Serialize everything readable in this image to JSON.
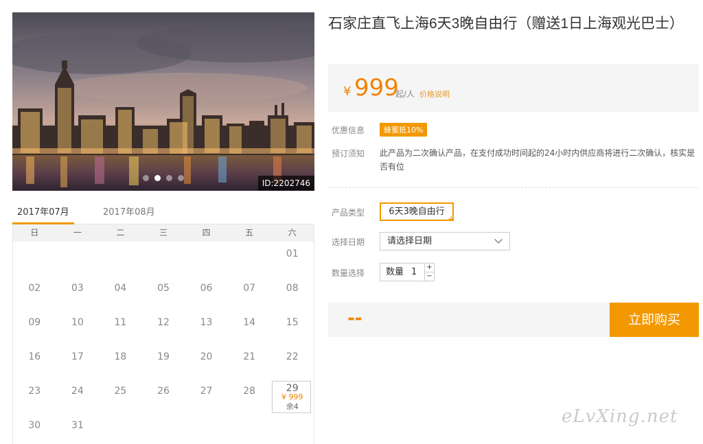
{
  "product": {
    "title": "石家庄直飞上海6天3晚自由行（赠送1日上海观光巴士）",
    "image_id": "ID:2202746",
    "price_currency": "¥",
    "price_amount": "999",
    "price_unit": "起/人",
    "price_explain": "价格说明"
  },
  "carousel": {
    "dot_count": 4,
    "active_dot": 1
  },
  "calendar": {
    "tabs": [
      {
        "label": "2017年07月",
        "active": true
      },
      {
        "label": "2017年08月",
        "active": false
      }
    ],
    "weekdays": [
      "日",
      "一",
      "二",
      "三",
      "四",
      "五",
      "六"
    ],
    "days": [
      {
        "col": 6,
        "day": "01"
      },
      {
        "day": "02"
      },
      {
        "day": "03"
      },
      {
        "day": "04"
      },
      {
        "day": "05"
      },
      {
        "day": "06"
      },
      {
        "day": "07"
      },
      {
        "day": "08"
      },
      {
        "day": "09"
      },
      {
        "day": "10"
      },
      {
        "day": "11"
      },
      {
        "day": "12"
      },
      {
        "day": "13"
      },
      {
        "day": "14"
      },
      {
        "day": "15"
      },
      {
        "day": "16"
      },
      {
        "day": "17"
      },
      {
        "day": "18"
      },
      {
        "day": "19"
      },
      {
        "day": "20"
      },
      {
        "day": "21"
      },
      {
        "day": "22"
      },
      {
        "day": "23"
      },
      {
        "day": "24"
      },
      {
        "day": "25"
      },
      {
        "day": "26"
      },
      {
        "day": "27"
      },
      {
        "day": "28"
      },
      {
        "day": "29",
        "price": "¥ 999",
        "stock": "余4"
      },
      {
        "day": "30"
      },
      {
        "day": "31"
      }
    ]
  },
  "details": {
    "promo_label": "优惠信息",
    "promo_tag": "蜂蜜抵10%",
    "notice_label": "预订须知",
    "notice_text": "此产品为二次确认产品，在支付成功时间起的24小时内供应商将进行二次确认，核实是否有位"
  },
  "form": {
    "type_label": "产品类型",
    "type_value": "6天3晚自由行",
    "date_label": "选择日期",
    "date_placeholder": "请选择日期",
    "qty_label": "数量选择",
    "qty_prefix": "数量",
    "qty_value": "1",
    "qty_plus": "+",
    "qty_minus": "−"
  },
  "purchase": {
    "total": "--",
    "buy_label": "立即购买"
  },
  "watermark": "eLvXing.net",
  "colors": {
    "accent": "#f39800",
    "price": "#f08300"
  }
}
